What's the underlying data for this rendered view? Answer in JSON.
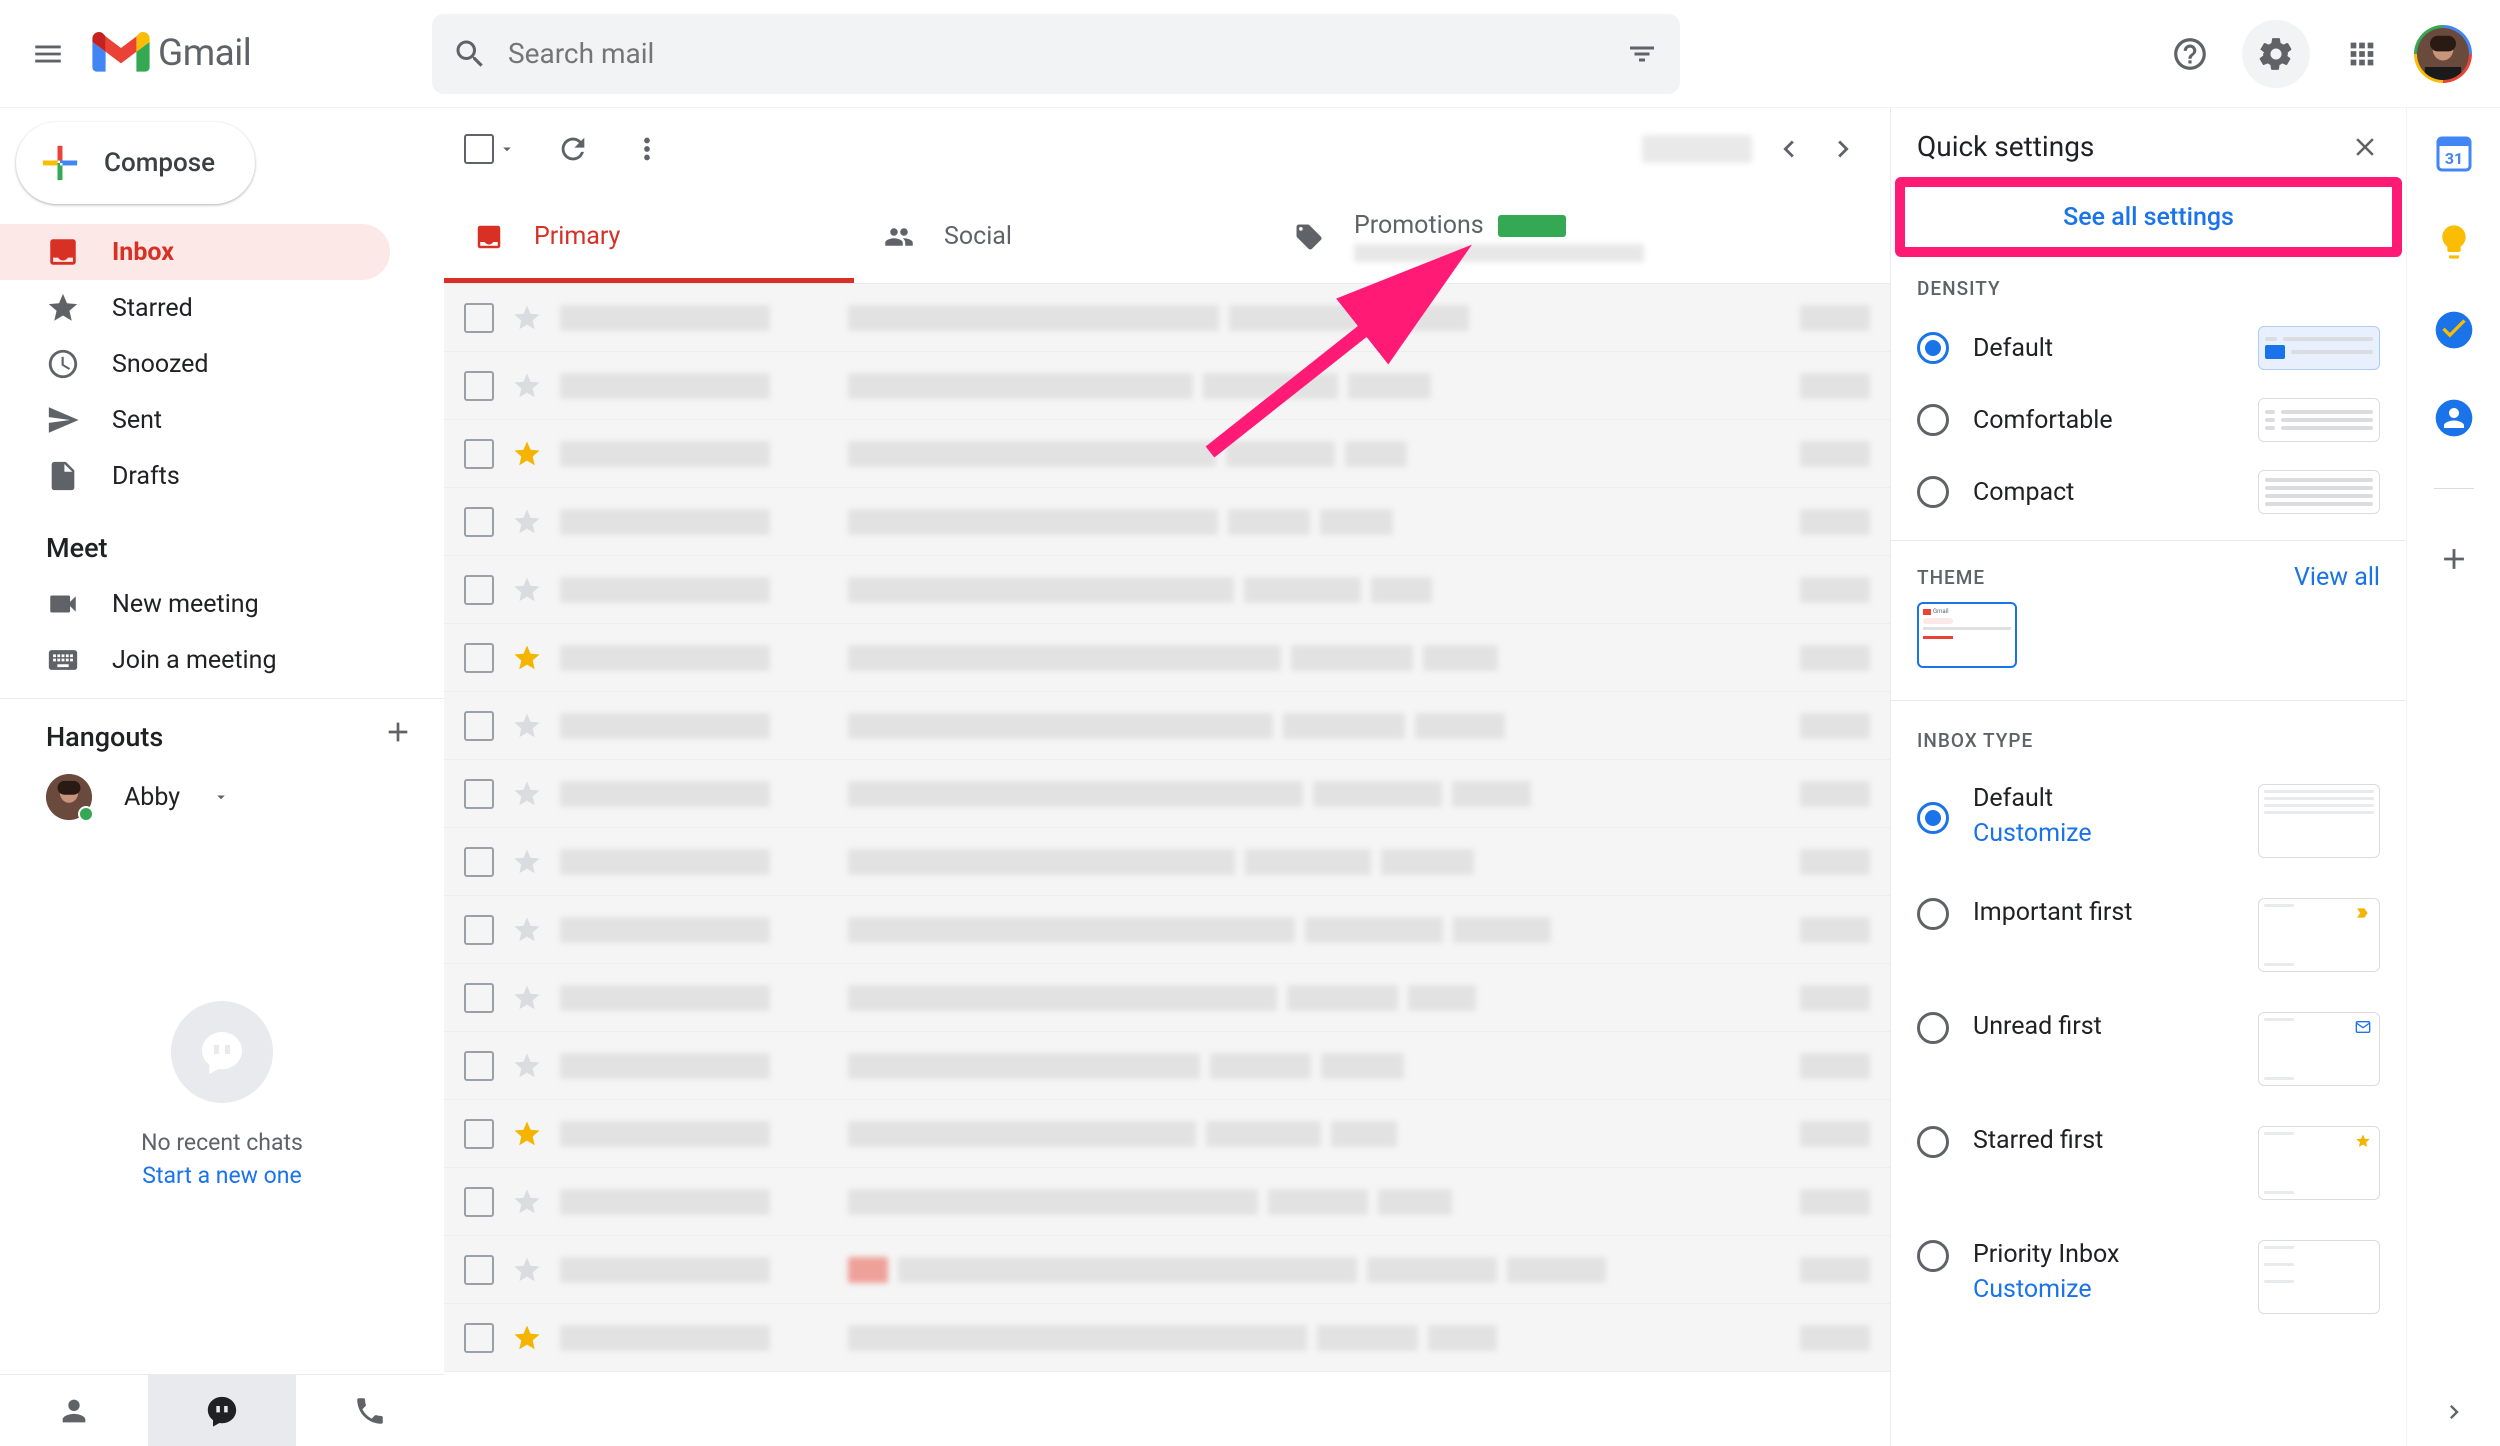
{
  "header": {
    "app_name": "Gmail",
    "search_placeholder": "Search mail"
  },
  "compose_label": "Compose",
  "sidebar": {
    "items": [
      {
        "label": "Inbox",
        "icon": "inbox"
      },
      {
        "label": "Starred",
        "icon": "star"
      },
      {
        "label": "Snoozed",
        "icon": "clock"
      },
      {
        "label": "Sent",
        "icon": "send"
      },
      {
        "label": "Drafts",
        "icon": "file"
      }
    ],
    "meet_title": "Meet",
    "meet_items": [
      {
        "label": "New meeting"
      },
      {
        "label": "Join a meeting"
      }
    ],
    "hangouts_title": "Hangouts",
    "hangouts_user": "Abby",
    "no_chats": "No recent chats",
    "start_one": "Start a new one"
  },
  "tabs": [
    {
      "label": "Primary"
    },
    {
      "label": "Social"
    },
    {
      "label": "Promotions"
    }
  ],
  "email_rows": [
    {
      "starred": false
    },
    {
      "starred": false
    },
    {
      "starred": true
    },
    {
      "starred": false
    },
    {
      "starred": false
    },
    {
      "starred": true
    },
    {
      "starred": false
    },
    {
      "starred": false
    },
    {
      "starred": false
    },
    {
      "starred": false
    },
    {
      "starred": false
    },
    {
      "starred": false
    },
    {
      "starred": true
    },
    {
      "starred": false
    },
    {
      "starred": false,
      "red": true
    },
    {
      "starred": true
    }
  ],
  "settings": {
    "title": "Quick settings",
    "see_all": "See all settings",
    "density_title": "DENSITY",
    "density_options": [
      "Default",
      "Comfortable",
      "Compact"
    ],
    "theme_title": "THEME",
    "view_all": "View all",
    "inbox_title": "INBOX TYPE",
    "inbox_options": [
      {
        "label": "Default",
        "customize": "Customize"
      },
      {
        "label": "Important first"
      },
      {
        "label": "Unread first"
      },
      {
        "label": "Starred first"
      },
      {
        "label": "Priority Inbox",
        "customize": "Customize"
      }
    ]
  }
}
